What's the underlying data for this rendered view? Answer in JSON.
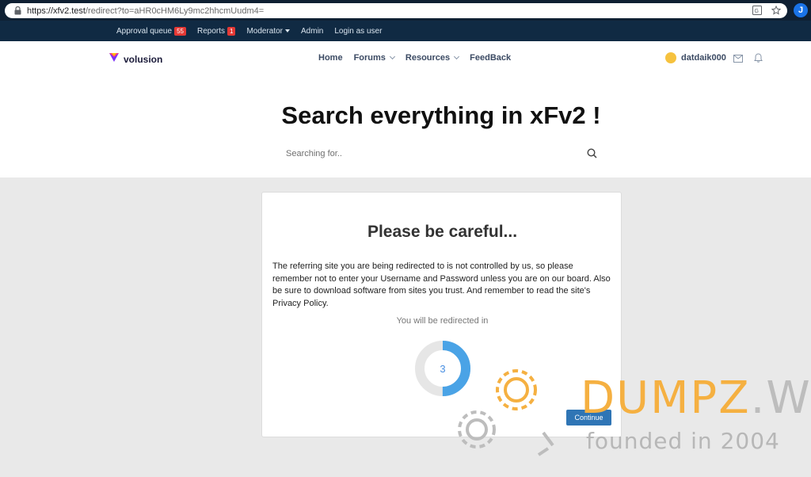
{
  "browser": {
    "url_host": "https://xfv2.test",
    "url_path": "/redirect?to=aHR0cHM6Ly9mc2hhcmUudm4=",
    "profile_initial": "J"
  },
  "staff_bar": {
    "approval_label": "Approval queue",
    "approval_count": "55",
    "reports_label": "Reports",
    "reports_count": "1",
    "moderator_label": "Moderator",
    "admin_label": "Admin",
    "login_as_user_label": "Login as user"
  },
  "header": {
    "logo_text": "volusion",
    "nav": [
      "Home",
      "Forums",
      "Resources",
      "FeedBack"
    ],
    "username": "datdaik000"
  },
  "hero": {
    "title": "Search everything in xFv2 !",
    "search_placeholder": "Searching for.."
  },
  "card": {
    "title": "Please be careful...",
    "message": "The referring site you are being redirected to is not controlled by us, so please remember not to enter your Username and Password unless you are on our board. Also be sure to download software from sites you trust. And remember to read the site's Privacy Policy.",
    "redirect_label": "You will be redirected in",
    "countdown": "3",
    "continue_label": "Continue"
  },
  "watermark": {
    "brand_part1": "DUMPZ",
    "brand_part2": ".WS",
    "tagline": "founded in 2004"
  },
  "colors": {
    "staff_bar_bg": "#102a43",
    "accent_blue": "#2f75b5",
    "badge_red": "#e53935",
    "watermark_orange": "#f5b041"
  }
}
